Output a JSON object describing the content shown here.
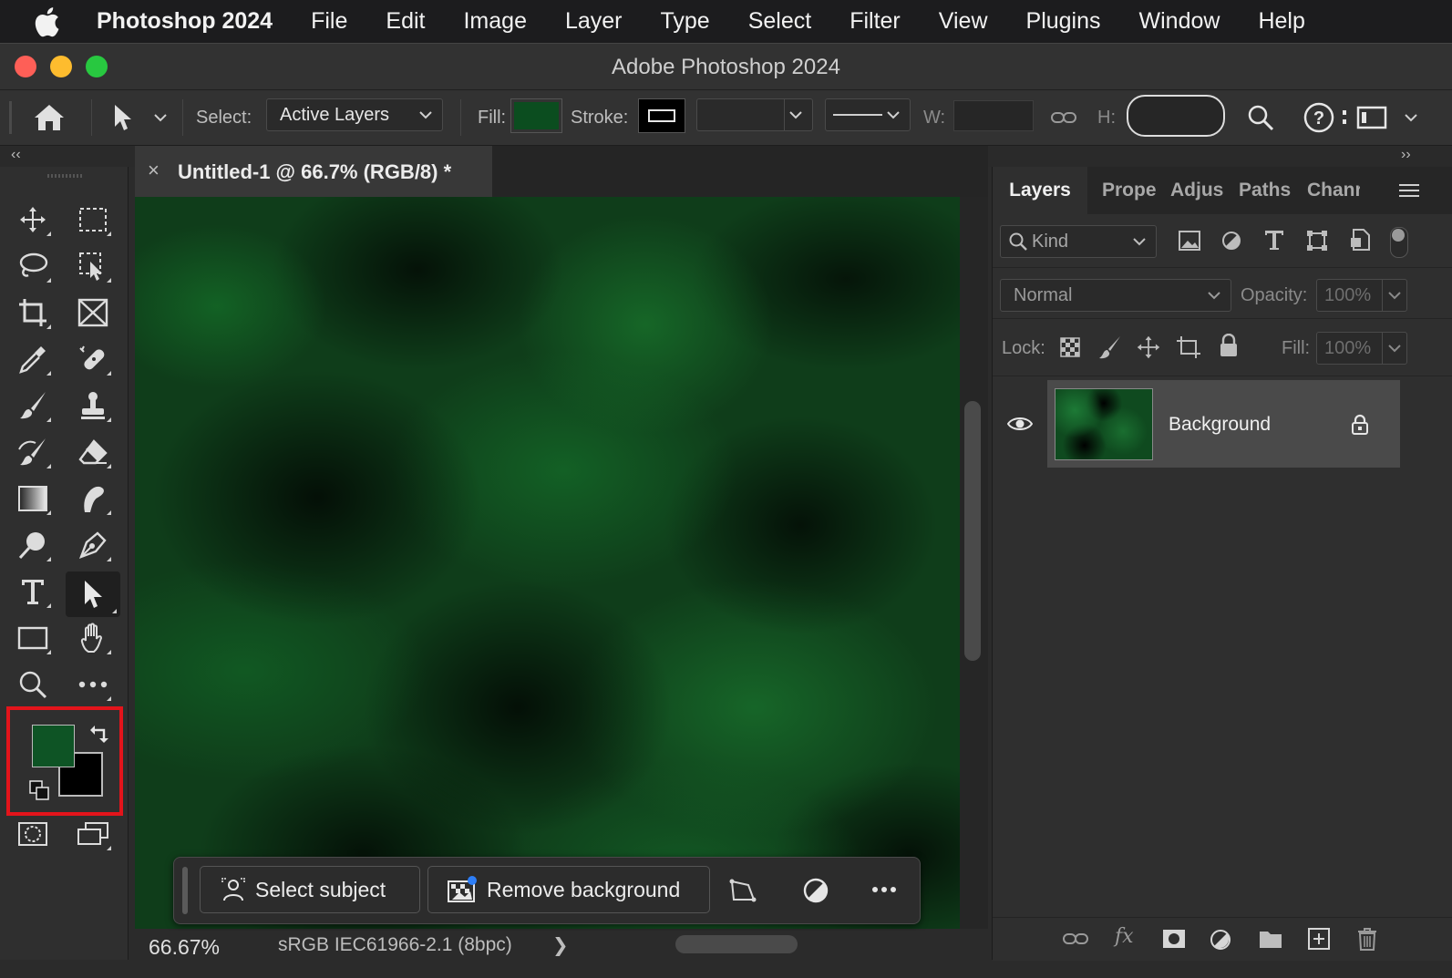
{
  "menubar": {
    "app": "Photoshop 2024",
    "items": [
      "File",
      "Edit",
      "Image",
      "Layer",
      "Type",
      "Select",
      "Filter",
      "View",
      "Plugins",
      "Window",
      "Help"
    ]
  },
  "window": {
    "title": "Adobe Photoshop 2024"
  },
  "options": {
    "select_label": "Select:",
    "select_value": "Active Layers",
    "fill_label": "Fill:",
    "fill_color": "#0b4d1f",
    "stroke_label": "Stroke:",
    "w_label": "W:",
    "h_label": "H:"
  },
  "document": {
    "tab_title": "Untitled-1 @ 66.7% (RGB/8) *",
    "zoom": "66.67%",
    "profile": "sRGB IEC61966-2.1 (8bpc)",
    "status_arrow": "❯"
  },
  "taskbar": {
    "select_subject": "Select subject",
    "remove_background": "Remove background"
  },
  "colors": {
    "foreground": "#0e5425",
    "background": "#000000",
    "highlight": "#e3141b"
  },
  "panel": {
    "tabs": [
      "Layers",
      "Prope",
      "Adjus",
      "Paths",
      "Chanr"
    ],
    "filter_kind": "Kind",
    "blend_mode": "Normal",
    "opacity_label": "Opacity:",
    "opacity_value": "100%",
    "lock_label": "Lock:",
    "fill_label": "Fill:",
    "fill_value": "100%",
    "layers": [
      {
        "name": "Background"
      }
    ]
  },
  "collapse": {
    "left": "‹‹",
    "right": "››"
  }
}
